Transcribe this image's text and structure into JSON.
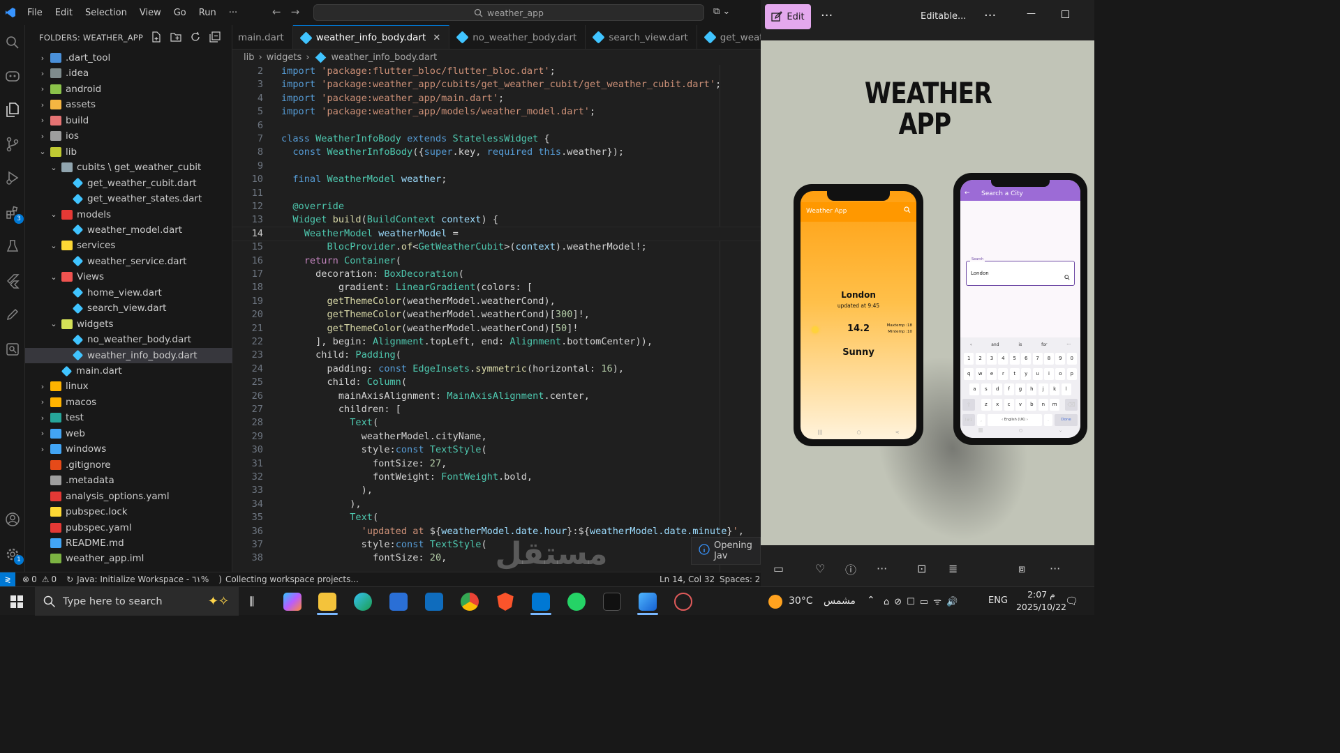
{
  "titlebar": {
    "menu": [
      "File",
      "Edit",
      "Selection",
      "View",
      "Go",
      "Run",
      "···"
    ],
    "command_center": "weather_app"
  },
  "sidebar": {
    "header": "FOLDERS: WEATHER_APP",
    "tree": [
      {
        "label": ".dart_tool",
        "depth": 0,
        "chev": ">",
        "color": "#4a90d9"
      },
      {
        "label": ".idea",
        "depth": 0,
        "chev": ">",
        "color": "#7f8c8d"
      },
      {
        "label": "android",
        "depth": 0,
        "chev": ">",
        "color": "#8bc34a"
      },
      {
        "label": "assets",
        "depth": 0,
        "chev": ">",
        "color": "#f5b642"
      },
      {
        "label": "build",
        "depth": 0,
        "chev": ">",
        "color": "#e57373"
      },
      {
        "label": "ios",
        "depth": 0,
        "chev": ">",
        "color": "#9e9e9e"
      },
      {
        "label": "lib",
        "depth": 0,
        "chev": "v",
        "color": "#c0ca33"
      },
      {
        "label": "cubits \\ get_weather_cubit",
        "depth": 1,
        "chev": "v",
        "color": "#90a4ae"
      },
      {
        "label": "get_weather_cubit.dart",
        "depth": 2,
        "chev": "",
        "color": "#40c4ff"
      },
      {
        "label": "get_weather_states.dart",
        "depth": 2,
        "chev": "",
        "color": "#40c4ff"
      },
      {
        "label": "models",
        "depth": 1,
        "chev": "v",
        "color": "#e53935"
      },
      {
        "label": "weather_model.dart",
        "depth": 2,
        "chev": "",
        "color": "#40c4ff"
      },
      {
        "label": "services",
        "depth": 1,
        "chev": "v",
        "color": "#fdd835"
      },
      {
        "label": "weather_service.dart",
        "depth": 2,
        "chev": "",
        "color": "#40c4ff"
      },
      {
        "label": "Views",
        "depth": 1,
        "chev": "v",
        "color": "#ef5350"
      },
      {
        "label": "home_view.dart",
        "depth": 2,
        "chev": "",
        "color": "#40c4ff"
      },
      {
        "label": "search_view.dart",
        "depth": 2,
        "chev": "",
        "color": "#40c4ff"
      },
      {
        "label": "widgets",
        "depth": 1,
        "chev": "v",
        "color": "#d4e157"
      },
      {
        "label": "no_weather_body.dart",
        "depth": 2,
        "chev": "",
        "color": "#40c4ff"
      },
      {
        "label": "weather_info_body.dart",
        "depth": 2,
        "chev": "",
        "color": "#40c4ff",
        "selected": true
      },
      {
        "label": "main.dart",
        "depth": 1,
        "chev": "",
        "color": "#40c4ff"
      },
      {
        "label": "linux",
        "depth": 0,
        "chev": ">",
        "color": "#ffb300"
      },
      {
        "label": "macos",
        "depth": 0,
        "chev": ">",
        "color": "#ffb300"
      },
      {
        "label": "test",
        "depth": 0,
        "chev": ">",
        "color": "#26a69a"
      },
      {
        "label": "web",
        "depth": 0,
        "chev": ">",
        "color": "#42a5f5"
      },
      {
        "label": "windows",
        "depth": 0,
        "chev": ">",
        "color": "#42a5f5"
      },
      {
        "label": ".gitignore",
        "depth": 0,
        "chev": "",
        "color": "#e64a19"
      },
      {
        "label": ".metadata",
        "depth": 0,
        "chev": "",
        "color": "#9e9e9e"
      },
      {
        "label": "analysis_options.yaml",
        "depth": 0,
        "chev": "",
        "color": "#e53935"
      },
      {
        "label": "pubspec.lock",
        "depth": 0,
        "chev": "",
        "color": "#fdd835"
      },
      {
        "label": "pubspec.yaml",
        "depth": 0,
        "chev": "",
        "color": "#e53935"
      },
      {
        "label": "README.md",
        "depth": 0,
        "chev": "",
        "color": "#42a5f5"
      },
      {
        "label": "weather_app.iml",
        "depth": 0,
        "chev": "",
        "color": "#7cb342"
      }
    ]
  },
  "tabs": [
    {
      "label": "main.dart",
      "active": false
    },
    {
      "label": "weather_info_body.dart",
      "active": true
    },
    {
      "label": "no_weather_body.dart",
      "active": false
    },
    {
      "label": "search_view.dart",
      "active": false
    },
    {
      "label": "get_weather_",
      "active": false
    }
  ],
  "breadcrumb": [
    "lib",
    "widgets",
    "weather_info_body.dart"
  ],
  "code": [
    {
      "n": "2",
      "tokens": [
        [
          "k",
          "import "
        ],
        [
          "s",
          "'package:flutter_bloc/flutter_bloc.dart'"
        ],
        [
          "p",
          ";"
        ]
      ]
    },
    {
      "n": "3",
      "tokens": [
        [
          "k",
          "import "
        ],
        [
          "s",
          "'package:weather_app/cubits/get_weather_cubit/get_weather_cubit.dart'"
        ],
        [
          "p",
          ";"
        ]
      ]
    },
    {
      "n": "4",
      "tokens": [
        [
          "k",
          "import "
        ],
        [
          "s",
          "'package:weather_app/main.dart'"
        ],
        [
          "p",
          ";"
        ]
      ]
    },
    {
      "n": "5",
      "tokens": [
        [
          "k",
          "import "
        ],
        [
          "s",
          "'package:weather_app/models/weather_model.dart'"
        ],
        [
          "p",
          ";"
        ]
      ]
    },
    {
      "n": "6",
      "tokens": []
    },
    {
      "n": "7",
      "tokens": [
        [
          "k",
          "class "
        ],
        [
          "t",
          "WeatherInfoBody "
        ],
        [
          "k",
          "extends "
        ],
        [
          "t",
          "StatelessWidget "
        ],
        [
          "p",
          "{"
        ]
      ]
    },
    {
      "n": "8",
      "tokens": [
        [
          "p",
          "  "
        ],
        [
          "k",
          "const "
        ],
        [
          "t",
          "WeatherInfoBody"
        ],
        [
          "p",
          "({"
        ],
        [
          "k",
          "super"
        ],
        [
          "p",
          ".key, "
        ],
        [
          "k",
          "required "
        ],
        [
          "k",
          "this"
        ],
        [
          "p",
          ".weather});"
        ]
      ]
    },
    {
      "n": "9",
      "tokens": []
    },
    {
      "n": "10",
      "tokens": [
        [
          "p",
          "  "
        ],
        [
          "k",
          "final "
        ],
        [
          "t",
          "WeatherModel "
        ],
        [
          "v",
          "weather"
        ],
        [
          "p",
          ";"
        ]
      ]
    },
    {
      "n": "11",
      "tokens": []
    },
    {
      "n": "12",
      "tokens": [
        [
          "p",
          "  "
        ],
        [
          "t",
          "@override"
        ]
      ]
    },
    {
      "n": "13",
      "tokens": [
        [
          "p",
          "  "
        ],
        [
          "t",
          "Widget "
        ],
        [
          "f",
          "build"
        ],
        [
          "p",
          "("
        ],
        [
          "t",
          "BuildContext "
        ],
        [
          "v",
          "context"
        ],
        [
          "p",
          ") {"
        ]
      ]
    },
    {
      "n": "14",
      "tokens": [
        [
          "p",
          "    "
        ],
        [
          "t",
          "WeatherModel "
        ],
        [
          "v",
          "weatherModel "
        ],
        [
          "p",
          "="
        ]
      ],
      "current": true
    },
    {
      "n": "15",
      "tokens": [
        [
          "p",
          "        "
        ],
        [
          "t",
          "BlocProvider"
        ],
        [
          "p",
          "."
        ],
        [
          "f",
          "of"
        ],
        [
          "p",
          "<"
        ],
        [
          "t",
          "GetWeatherCubit"
        ],
        [
          "p",
          ">("
        ],
        [
          "v",
          "context"
        ],
        [
          "p",
          ").weatherModel!;"
        ]
      ]
    },
    {
      "n": "16",
      "tokens": [
        [
          "p",
          "    "
        ],
        [
          "c",
          "return "
        ],
        [
          "t",
          "Container"
        ],
        [
          "p",
          "("
        ]
      ]
    },
    {
      "n": "17",
      "tokens": [
        [
          "p",
          "      decoration: "
        ],
        [
          "t",
          "BoxDecoration"
        ],
        [
          "p",
          "("
        ]
      ]
    },
    {
      "n": "18",
      "tokens": [
        [
          "p",
          "          gradient: "
        ],
        [
          "t",
          "LinearGradient"
        ],
        [
          "p",
          "(colors: ["
        ]
      ]
    },
    {
      "n": "19",
      "tokens": [
        [
          "p",
          "        "
        ],
        [
          "f",
          "getThemeColor"
        ],
        [
          "p",
          "(weatherModel.weatherCond),"
        ]
      ]
    },
    {
      "n": "20",
      "tokens": [
        [
          "p",
          "        "
        ],
        [
          "f",
          "getThemeColor"
        ],
        [
          "p",
          "(weatherModel.weatherCond)["
        ],
        [
          "n",
          "300"
        ],
        [
          "p",
          "]!,"
        ]
      ]
    },
    {
      "n": "21",
      "tokens": [
        [
          "p",
          "        "
        ],
        [
          "f",
          "getThemeColor"
        ],
        [
          "p",
          "(weatherModel.weatherCond)["
        ],
        [
          "n",
          "50"
        ],
        [
          "p",
          "]!"
        ]
      ]
    },
    {
      "n": "22",
      "tokens": [
        [
          "p",
          "      ], begin: "
        ],
        [
          "t",
          "Alignment"
        ],
        [
          "p",
          ".topLeft, end: "
        ],
        [
          "t",
          "Alignment"
        ],
        [
          "p",
          ".bottomCenter)),"
        ]
      ]
    },
    {
      "n": "23",
      "tokens": [
        [
          "p",
          "      child: "
        ],
        [
          "t",
          "Padding"
        ],
        [
          "p",
          "("
        ]
      ]
    },
    {
      "n": "24",
      "tokens": [
        [
          "p",
          "        padding: "
        ],
        [
          "k",
          "const "
        ],
        [
          "t",
          "EdgeInsets"
        ],
        [
          "p",
          "."
        ],
        [
          "f",
          "symmetric"
        ],
        [
          "p",
          "(horizontal: "
        ],
        [
          "n",
          "16"
        ],
        [
          "p",
          "),"
        ]
      ]
    },
    {
      "n": "25",
      "tokens": [
        [
          "p",
          "        child: "
        ],
        [
          "t",
          "Column"
        ],
        [
          "p",
          "("
        ]
      ]
    },
    {
      "n": "26",
      "tokens": [
        [
          "p",
          "          mainAxisAlignment: "
        ],
        [
          "t",
          "MainAxisAlignment"
        ],
        [
          "p",
          ".center,"
        ]
      ]
    },
    {
      "n": "27",
      "tokens": [
        [
          "p",
          "          children: ["
        ]
      ]
    },
    {
      "n": "28",
      "tokens": [
        [
          "p",
          "            "
        ],
        [
          "t",
          "Text"
        ],
        [
          "p",
          "("
        ]
      ]
    },
    {
      "n": "29",
      "tokens": [
        [
          "p",
          "              weatherModel.cityName,"
        ]
      ]
    },
    {
      "n": "30",
      "tokens": [
        [
          "p",
          "              style:"
        ],
        [
          "k",
          "const "
        ],
        [
          "t",
          "TextStyle"
        ],
        [
          "p",
          "("
        ]
      ]
    },
    {
      "n": "31",
      "tokens": [
        [
          "p",
          "                fontSize: "
        ],
        [
          "n",
          "27"
        ],
        [
          "p",
          ","
        ]
      ]
    },
    {
      "n": "32",
      "tokens": [
        [
          "p",
          "                fontWeight: "
        ],
        [
          "t",
          "FontWeight"
        ],
        [
          "p",
          ".bold,"
        ]
      ]
    },
    {
      "n": "33",
      "tokens": [
        [
          "p",
          "              ),"
        ]
      ]
    },
    {
      "n": "34",
      "tokens": [
        [
          "p",
          "            ),"
        ]
      ]
    },
    {
      "n": "35",
      "tokens": [
        [
          "p",
          "            "
        ],
        [
          "t",
          "Text"
        ],
        [
          "p",
          "("
        ]
      ]
    },
    {
      "n": "36",
      "tokens": [
        [
          "p",
          "              "
        ],
        [
          "s",
          "'updated at "
        ],
        [
          "p",
          "${"
        ],
        [
          "v",
          "weatherModel.date.hour"
        ],
        [
          "p",
          "}:${"
        ],
        [
          "v",
          "weatherModel.date.minute"
        ],
        [
          "p",
          "}"
        ],
        [
          "s",
          "'"
        ],
        [
          "p",
          ","
        ]
      ]
    },
    {
      "n": "37",
      "tokens": [
        [
          "p",
          "              style:"
        ],
        [
          "k",
          "const "
        ],
        [
          "t",
          "TextStyle"
        ],
        [
          "p",
          "("
        ]
      ]
    },
    {
      "n": "38",
      "tokens": [
        [
          "p",
          "                fontSize: "
        ],
        [
          "n",
          "20"
        ],
        [
          "p",
          ","
        ]
      ]
    }
  ],
  "toast": "Opening Jav",
  "statusbar": {
    "errors": "0",
    "warnings": "0",
    "java": "Java: Initialize Workspace - ٦١%",
    "task": "Collecting workspace projects...",
    "position": "Ln 14, Col 32",
    "spaces": "Spaces: 2"
  },
  "viewer": {
    "edit_label": "Edit",
    "file_label": "Editable...",
    "poster_title": [
      "WEATHER",
      "APP"
    ],
    "phone1": {
      "appbar": "Weather App",
      "city": "London",
      "updated": "updated at 9:45",
      "temp": "14.2",
      "max": "Maxtemp :18",
      "min": "Mintemp :10",
      "cond": "Sunny"
    },
    "phone2": {
      "appbar": "Search a City",
      "field_label": "Search",
      "field_value": "London",
      "suggestions": [
        "and",
        "is",
        "for"
      ],
      "kb_rows": [
        [
          "1",
          "2",
          "3",
          "4",
          "5",
          "6",
          "7",
          "8",
          "9",
          "0"
        ],
        [
          "q",
          "w",
          "e",
          "r",
          "t",
          "y",
          "u",
          "i",
          "o",
          "p"
        ],
        [
          "a",
          "s",
          "d",
          "f",
          "g",
          "h",
          "j",
          "k",
          "l"
        ],
        [
          "z",
          "x",
          "c",
          "v",
          "b",
          "n",
          "m"
        ]
      ],
      "space_label": "English (UK)",
      "sym_label": "!#1",
      "done_label": "Done"
    }
  },
  "taskbar": {
    "search_placeholder": "Type here to search",
    "weather": "30°C",
    "weather_desc": "مشمس",
    "lang": "ENG",
    "time": "2:07 م",
    "date": "2025/10/22"
  },
  "watermark": {
    "main": "مستقل",
    "sub": "mostaql.com"
  },
  "colors": {
    "accent": "#0078d4",
    "edit_button": "#e4a8ee",
    "orange": "#ff9800",
    "purple": "#9c6bd6"
  }
}
